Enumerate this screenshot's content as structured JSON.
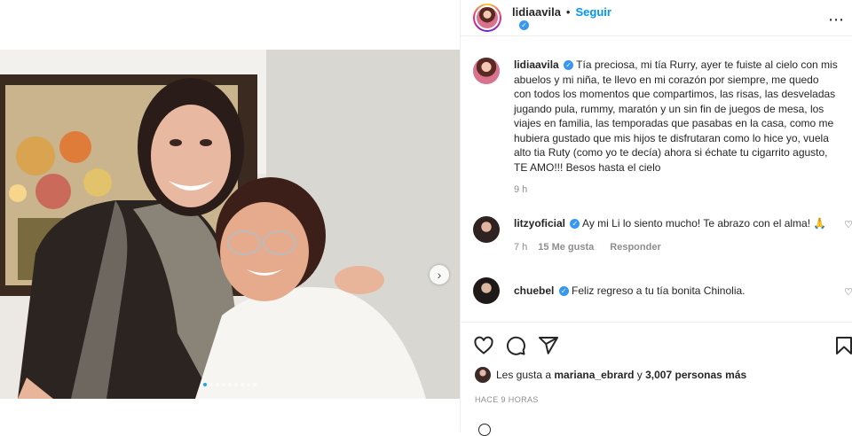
{
  "post": {
    "username": "lidiaavila",
    "follow_label": "Seguir",
    "separator": "•",
    "more_icon": "more-horizontal-icon",
    "carousel": {
      "next_icon": "chevron-right-icon",
      "slide_count": 9,
      "active_index": 0
    }
  },
  "caption": {
    "username": "lidiaavila",
    "text": "Tía preciosa, mi tía Rurry, ayer te fuiste al cielo con mis abuelos y mi niña, te llevo en mi corazón por siempre, me quedo con todos los momentos que compartimos, las risas, las desveladas jugando pula, rummy, maratón y un sin fin de juegos de mesa, los viajes en familia, las temporadas que pasabas en la casa, como me hubiera gustado que mis hijos te disfrutaran como lo hice yo, vuela alto tia Ruty (como yo te decía) ahora si échate tu cigarrito agusto, TE AMO!!! Besos hasta el cielo",
    "time": "9 h"
  },
  "comments": [
    {
      "username": "litzyoficial",
      "text": "Ay mi Li lo siento mucho! Te abrazo con el alma! 🙏",
      "time": "7 h",
      "likes": "15 Me gusta",
      "reply_label": "Responder"
    },
    {
      "username": "chuebel",
      "text": "Feliz regreso a tu tía bonita Chinolia."
    }
  ],
  "actions": {
    "like_icon": "heart-icon",
    "comment_icon": "comment-icon",
    "share_icon": "send-icon",
    "save_icon": "bookmark-icon"
  },
  "likes": {
    "prefix": "Les gusta a",
    "user": "mariana_ebrard",
    "connector": "y",
    "others": "3,007 personas más"
  },
  "time_ago": "HACE 9 HORAS",
  "colors": {
    "link": "#0095f6",
    "verified": "#3897f0",
    "muted": "#8e8e8e"
  }
}
